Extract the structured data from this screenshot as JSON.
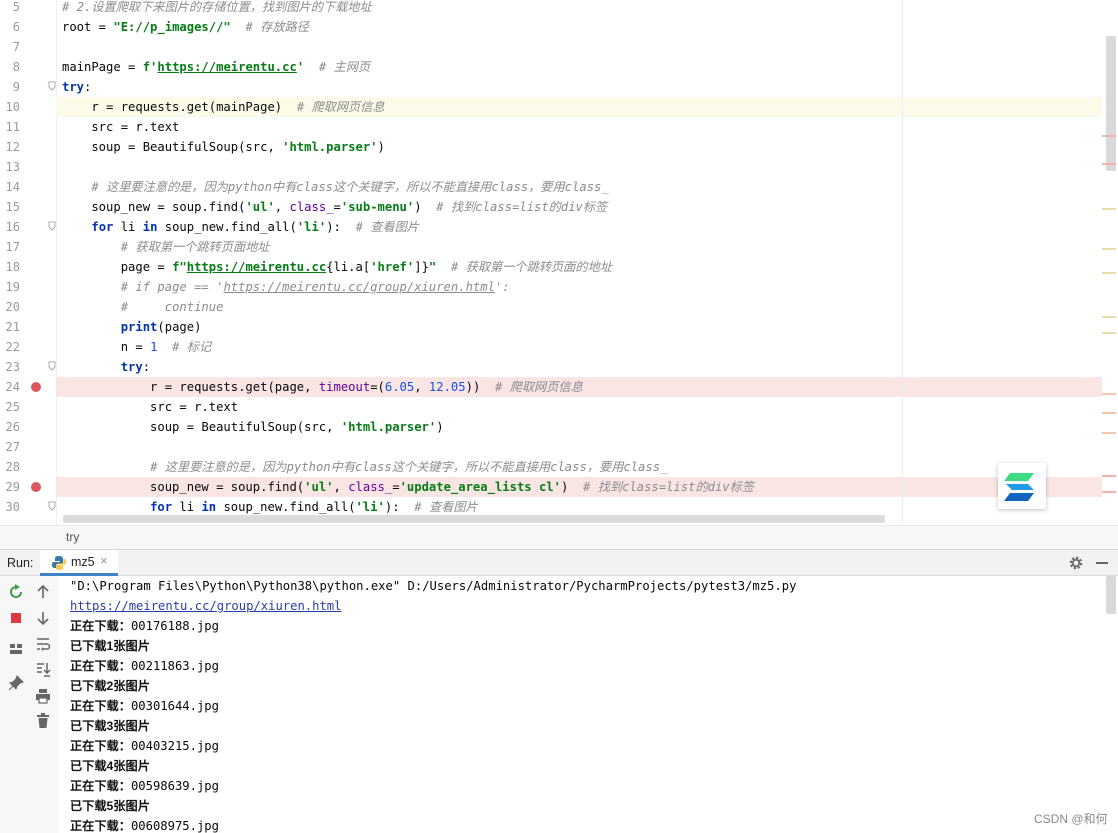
{
  "editor": {
    "lines": [
      {
        "n": "5",
        "toks": [
          [
            "cmt",
            "# 2.设置爬取下来图片的存储位置，找到图片的下载地址"
          ]
        ]
      },
      {
        "n": "6",
        "toks": [
          [
            "",
            "root = "
          ],
          [
            "str",
            "\"E://p_images//\""
          ],
          [
            "",
            "  "
          ],
          [
            "cmt",
            "# 存放路径"
          ]
        ]
      },
      {
        "n": "7",
        "toks": []
      },
      {
        "n": "8",
        "toks": [
          [
            "",
            "mainPage = "
          ],
          [
            "str",
            "f'"
          ],
          [
            "str url",
            "https://meirentu.cc"
          ],
          [
            "str",
            "'"
          ],
          [
            "",
            "  "
          ],
          [
            "cmt",
            "# 主网页"
          ]
        ]
      },
      {
        "n": "9",
        "fold": true,
        "toks": [
          [
            "kw",
            "try"
          ],
          [
            "",
            ":"
          ]
        ]
      },
      {
        "n": "10",
        "hl": "cur",
        "toks": [
          [
            "",
            "    r = requests.get(mainPage)  "
          ],
          [
            "cmt",
            "# 爬取网页信息"
          ]
        ]
      },
      {
        "n": "11",
        "toks": [
          [
            "",
            "    src = r.text"
          ]
        ]
      },
      {
        "n": "12",
        "toks": [
          [
            "",
            "    soup = BeautifulSoup(src, "
          ],
          [
            "str",
            "'html.parser'"
          ],
          [
            "",
            ")"
          ]
        ]
      },
      {
        "n": "13",
        "toks": []
      },
      {
        "n": "14",
        "toks": [
          [
            "",
            "    "
          ],
          [
            "cmt",
            "# 这里要注意的是，因为python中有class这个关键字，所以不能直接用class，要用class_"
          ]
        ]
      },
      {
        "n": "15",
        "toks": [
          [
            "",
            "    soup_new = soup.find("
          ],
          [
            "str",
            "'ul'"
          ],
          [
            "",
            ", "
          ],
          [
            "param",
            "class_"
          ],
          [
            "",
            "="
          ],
          [
            "str",
            "'sub-menu'"
          ],
          [
            "",
            ")  "
          ],
          [
            "cmt",
            "# 找到class=list的div标签"
          ]
        ]
      },
      {
        "n": "16",
        "fold": true,
        "toks": [
          [
            "",
            "    "
          ],
          [
            "kw",
            "for"
          ],
          [
            "",
            " li "
          ],
          [
            "kw",
            "in"
          ],
          [
            "",
            " soup_new.find_all("
          ],
          [
            "str",
            "'li'"
          ],
          [
            "",
            "):  "
          ],
          [
            "cmt",
            "# 查看图片"
          ]
        ]
      },
      {
        "n": "17",
        "toks": [
          [
            "",
            "        "
          ],
          [
            "cmt",
            "# 获取第一个跳转页面地址"
          ]
        ]
      },
      {
        "n": "18",
        "toks": [
          [
            "",
            "        page = "
          ],
          [
            "str",
            "f\""
          ],
          [
            "str url",
            "https://meirentu.cc"
          ],
          [
            "",
            "{li.a["
          ],
          [
            "str",
            "'href'"
          ],
          [
            "",
            "]}"
          ],
          [
            "str",
            "\""
          ],
          [
            "",
            "  "
          ],
          [
            "cmt",
            "# 获取第一个跳转页面的地址"
          ]
        ]
      },
      {
        "n": "19",
        "toks": [
          [
            "",
            "        "
          ],
          [
            "cmt",
            "# if page == '"
          ],
          [
            "cmt url",
            "https://meirentu.cc/group/xiuren.html"
          ],
          [
            "cmt",
            "':"
          ]
        ]
      },
      {
        "n": "20",
        "toks": [
          [
            "",
            "        "
          ],
          [
            "cmt",
            "#     continue"
          ]
        ]
      },
      {
        "n": "21",
        "toks": [
          [
            "",
            "        "
          ],
          [
            "kw",
            "print"
          ],
          [
            "",
            "(page)"
          ]
        ]
      },
      {
        "n": "22",
        "toks": [
          [
            "",
            "        n = "
          ],
          [
            "num",
            "1"
          ],
          [
            "",
            "  "
          ],
          [
            "cmt",
            "# 标记"
          ]
        ]
      },
      {
        "n": "23",
        "fold": true,
        "toks": [
          [
            "",
            "        "
          ],
          [
            "kw",
            "try"
          ],
          [
            "",
            ":"
          ]
        ]
      },
      {
        "n": "24",
        "hl": "bp",
        "bp": true,
        "toks": [
          [
            "",
            "            r = requests.get(page, "
          ],
          [
            "param",
            "timeout"
          ],
          [
            "",
            "=("
          ],
          [
            "num",
            "6.05"
          ],
          [
            "",
            ", "
          ],
          [
            "num",
            "12.05"
          ],
          [
            "",
            "))  "
          ],
          [
            "cmt",
            "# 爬取网页信息"
          ]
        ]
      },
      {
        "n": "25",
        "toks": [
          [
            "",
            "            src = r.text"
          ]
        ]
      },
      {
        "n": "26",
        "toks": [
          [
            "",
            "            soup = BeautifulSoup(src, "
          ],
          [
            "str",
            "'html.parser'"
          ],
          [
            "",
            ")"
          ]
        ]
      },
      {
        "n": "27",
        "toks": []
      },
      {
        "n": "28",
        "toks": [
          [
            "",
            "            "
          ],
          [
            "cmt",
            "# 这里要注意的是，因为python中有class这个关键字，所以不能直接用class，要用class_"
          ]
        ]
      },
      {
        "n": "29",
        "hl": "bp",
        "bp": true,
        "toks": [
          [
            "",
            "            soup_new = soup.find("
          ],
          [
            "str",
            "'ul'"
          ],
          [
            "",
            ", "
          ],
          [
            "param",
            "class_"
          ],
          [
            "",
            "="
          ],
          [
            "str",
            "'update_area_lists cl'"
          ],
          [
            "",
            ")  "
          ],
          [
            "cmt",
            "# 找到class=list的div标签"
          ]
        ]
      },
      {
        "n": "30",
        "fold": true,
        "toks": [
          [
            "",
            "            "
          ],
          [
            "kw",
            "for"
          ],
          [
            "",
            " li "
          ],
          [
            "kw",
            "in"
          ],
          [
            "",
            " soup_new.find_all("
          ],
          [
            "str",
            "'li'"
          ],
          [
            "",
            "):  "
          ],
          [
            "cmt",
            "# 查看图片"
          ]
        ]
      }
    ]
  },
  "breadcrumb": "try",
  "run": {
    "label": "Run:",
    "tab": "mz5",
    "tab_close": "×"
  },
  "console": {
    "command": "\"D:\\Program Files\\Python\\Python38\\python.exe\" D:/Users/Administrator/PycharmProjects/pytest3/mz5.py",
    "link": "https://meirentu.cc/group/xiuren.html",
    "output": [
      {
        "label": "正在下载：",
        "value": "00176188.jpg"
      },
      {
        "label": "已下载1张图片",
        "value": ""
      },
      {
        "label": "正在下载：",
        "value": "00211863.jpg"
      },
      {
        "label": "已下载2张图片",
        "value": ""
      },
      {
        "label": "正在下载：",
        "value": "00301644.jpg"
      },
      {
        "label": "已下载3张图片",
        "value": ""
      },
      {
        "label": "正在下载：",
        "value": "00403215.jpg"
      },
      {
        "label": "已下载4张图片",
        "value": ""
      },
      {
        "label": "正在下载：",
        "value": "00598639.jpg"
      },
      {
        "label": "已下载5张图片",
        "value": ""
      },
      {
        "label": "正在下载：",
        "value": "00608975.jpg"
      }
    ]
  },
  "watermark": "CSDN @和何",
  "colors": {
    "accent": "#4083c9",
    "breakpoint": "#db5860",
    "current_line": "#fcfae8",
    "breakpoint_line": "#f9e5e3"
  }
}
